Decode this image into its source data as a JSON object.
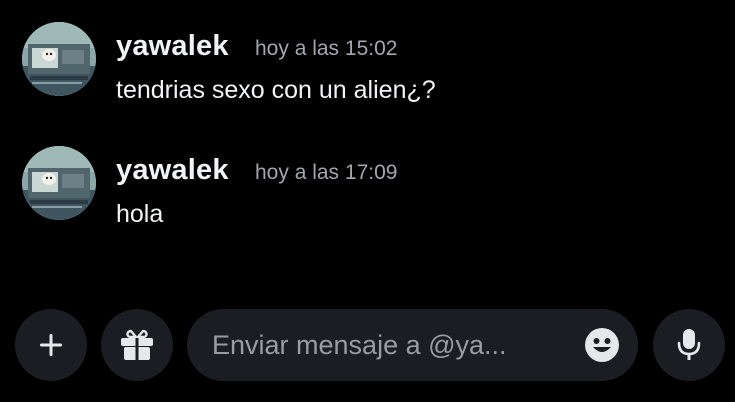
{
  "messages": [
    {
      "username": "yawalek",
      "timestamp": "hoy a las 15:02",
      "content": "tendrias sexo con un alien¿?"
    },
    {
      "username": "yawalek",
      "timestamp": "hoy a las 17:09",
      "content": "hola"
    }
  ],
  "composer": {
    "placeholder": "Enviar mensaje a @ya...",
    "add_icon": "plus-icon",
    "gift_icon": "gift-icon",
    "emoji_icon": "emoji-icon",
    "mic_icon": "microphone-icon"
  },
  "colors": {
    "background": "#000000",
    "username": "#f2f3f5",
    "timestamp": "#a3a6ac",
    "text": "#f2f3f5",
    "composer_bg": "#1c1d22",
    "icon": "#e6e7ea"
  }
}
